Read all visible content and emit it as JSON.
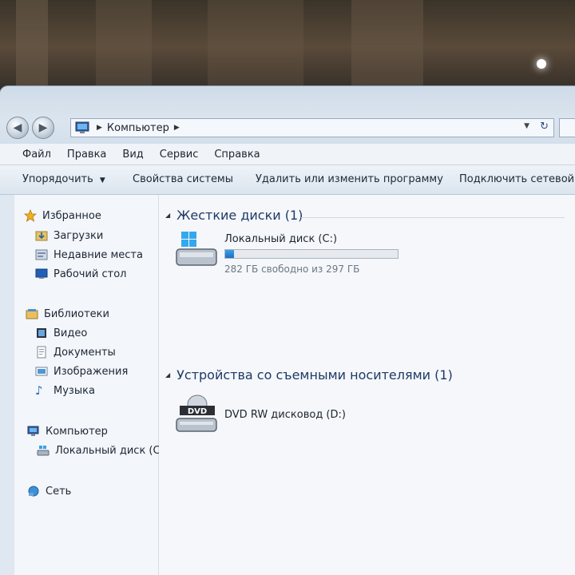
{
  "address": {
    "path": [
      "Компьютер"
    ]
  },
  "menu": [
    "Файл",
    "Правка",
    "Вид",
    "Сервис",
    "Справка"
  ],
  "toolbar": {
    "organize": "Упорядочить",
    "system_properties": "Свойства системы",
    "uninstall": "Удалить или изменить программу",
    "map_drive": "Подключить сетевой д"
  },
  "sidebar": {
    "favorites": {
      "label": "Избранное",
      "items": [
        "Загрузки",
        "Недавние места",
        "Рабочий стол"
      ]
    },
    "libraries": {
      "label": "Библиотеки",
      "items": [
        "Видео",
        "Документы",
        "Изображения",
        "Музыка"
      ]
    },
    "computer": {
      "label": "Компьютер",
      "items": [
        "Локальный диск (C"
      ]
    },
    "network": {
      "label": "Сеть"
    }
  },
  "groups": {
    "hard_disks": {
      "title": "Жесткие диски (1)",
      "drive_name": "Локальный диск (C:)",
      "free_text": "282 ГБ свободно из 297 ГБ",
      "used_fraction": 0.05
    },
    "removable": {
      "title": "Устройства со съемными носителями (1)",
      "drive_name": "DVD RW дисковод (D:)",
      "dvd_label": "DVD"
    }
  },
  "colors": {
    "accent": "#1f6fc2",
    "group_title": "#1e3a66",
    "window_bg": "#dfe8f1"
  }
}
